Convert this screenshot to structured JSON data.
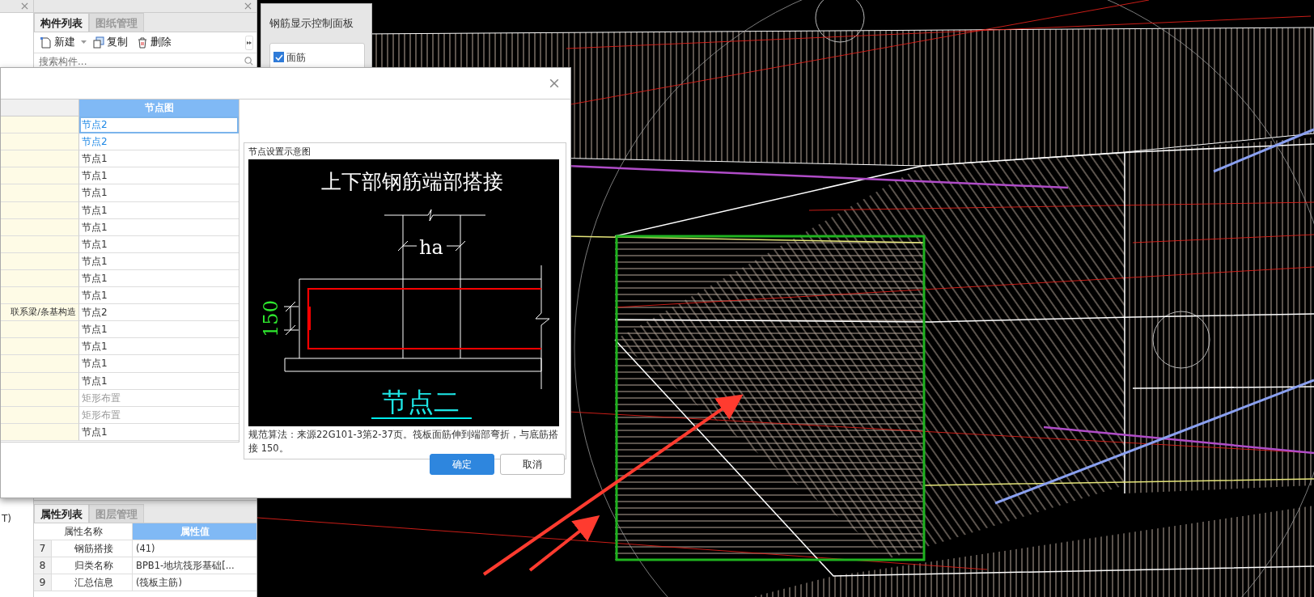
{
  "left_panel": {
    "fragment_text": "T)"
  },
  "component_panel": {
    "tabs": [
      {
        "label": "构件列表",
        "selected": true
      },
      {
        "label": "图纸管理",
        "selected": false
      }
    ],
    "toolbar": [
      {
        "kind": "new",
        "label": "新建"
      },
      {
        "kind": "copy",
        "label": "复制"
      },
      {
        "kind": "delete",
        "label": "删除"
      }
    ],
    "search": {
      "placeholder": "搜索构件..."
    }
  },
  "rebar_display_panel": {
    "title": "钢筋显示控制面板",
    "options": [
      {
        "label": "面筋",
        "checked": true
      }
    ]
  },
  "dialog": {
    "table": {
      "columns": [
        "节点图"
      ],
      "rows": [
        {
          "node_diagram": "节点2",
          "selected": true,
          "highlighted": true,
          "disabled": false
        },
        {
          "node_diagram": "节点2",
          "selected": false,
          "highlighted": true,
          "disabled": false
        },
        {
          "node_diagram": "节点1",
          "selected": false,
          "highlighted": false,
          "disabled": false
        },
        {
          "node_diagram": "节点1",
          "selected": false,
          "highlighted": false,
          "disabled": false
        },
        {
          "node_diagram": "节点1",
          "selected": false,
          "highlighted": false,
          "disabled": false
        },
        {
          "node_diagram": "节点1",
          "selected": false,
          "highlighted": false,
          "disabled": false
        },
        {
          "node_diagram": "节点1",
          "selected": false,
          "highlighted": false,
          "disabled": false
        },
        {
          "node_diagram": "节点1",
          "selected": false,
          "highlighted": false,
          "disabled": false
        },
        {
          "node_diagram": "节点1",
          "selected": false,
          "highlighted": false,
          "disabled": false
        },
        {
          "node_diagram": "节点1",
          "selected": false,
          "highlighted": false,
          "disabled": false
        },
        {
          "node_diagram": "节点1",
          "selected": false,
          "highlighted": false,
          "disabled": false
        },
        {
          "column_1": "联系梁/条基构造",
          "node_diagram": "节点2",
          "selected": false,
          "highlighted": false,
          "disabled": false
        },
        {
          "node_diagram": "节点1",
          "selected": false,
          "highlighted": false,
          "disabled": false
        },
        {
          "node_diagram": "节点1",
          "selected": false,
          "highlighted": false,
          "disabled": false
        },
        {
          "node_diagram": "节点1",
          "selected": false,
          "highlighted": false,
          "disabled": false
        },
        {
          "node_diagram": "节点1",
          "selected": false,
          "highlighted": false,
          "disabled": false
        },
        {
          "node_diagram": "矩形布置",
          "selected": false,
          "highlighted": false,
          "disabled": true
        },
        {
          "node_diagram": "矩形布置",
          "selected": false,
          "highlighted": false,
          "disabled": true
        },
        {
          "node_diagram": "节点1",
          "selected": false,
          "highlighted": false,
          "disabled": false
        }
      ]
    },
    "preview": {
      "title": "节点设置示意图",
      "diagram": {
        "heading": "上下部钢筋端部搭接",
        "dimension_label": "ha",
        "offset_label": "150",
        "node_label": "节点二"
      },
      "description": "规范算法：来源22G101-3第2-37页。筏板面筋伸到端部弯折，与底筋搭接 150。"
    },
    "buttons": [
      {
        "kind": "primary",
        "label": "确定"
      },
      {
        "kind": "secondary",
        "label": "取消"
      }
    ]
  },
  "property_panel": {
    "tabs": [
      {
        "label": "属性列表",
        "selected": true
      },
      {
        "label": "图层管理",
        "selected": false
      }
    ],
    "columns": [
      "属性名称",
      "属性值"
    ],
    "rows": [
      {
        "index": "7",
        "name": "钢筋搭接",
        "value": "(41)"
      },
      {
        "index": "8",
        "name": "归类名称",
        "value": "BPB1-地坑筏形基础[..."
      },
      {
        "index": "9",
        "name": "汇总信息",
        "value": "(筏板主筋)"
      }
    ]
  }
}
